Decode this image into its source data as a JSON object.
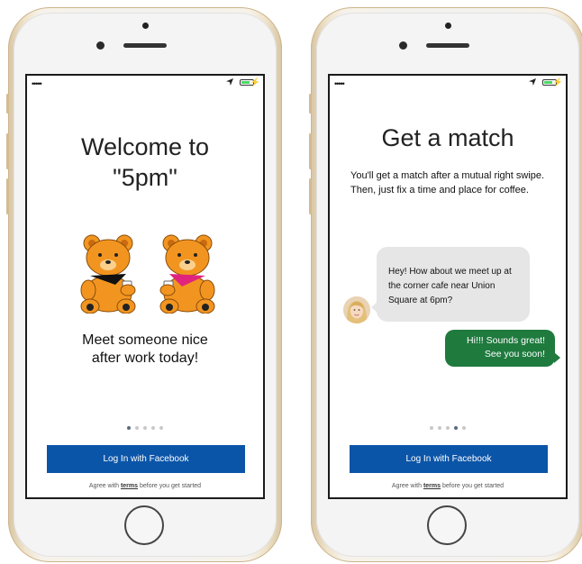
{
  "status": {
    "signal": "•••••",
    "charge": "⚡"
  },
  "screens": [
    {
      "id": "welcome",
      "title": "Welcome to\n\"5pm\"",
      "tagline": "Meet someone nice\nafter work today!",
      "dots_total": 5,
      "active_dot": 0,
      "login_button": "Log In with Facebook",
      "terms": {
        "before": "Agree with ",
        "link": "terms",
        "after": " before you get started"
      }
    },
    {
      "id": "get-match",
      "title": "Get a match",
      "description": "You'll get a match after a mutual right swipe. Then, just fix a time and place for coffee.",
      "incoming_message": "Hey! How about we meet up at the corner cafe near Union Square at 6pm?",
      "outgoing_message": "Hi!!! Sounds great!\nSee you soon!",
      "dots_total": 5,
      "active_dot": 3,
      "login_button": "Log In with Facebook",
      "terms": {
        "before": "Agree with ",
        "link": "terms",
        "after": " before you get started"
      }
    }
  ],
  "colors": {
    "facebook_blue": "#0b55a8",
    "outgoing_bubble": "#1f7a3e",
    "incoming_bubble": "#e6e6e6",
    "bear_fur": "#f29520",
    "bandana_left": "#111111",
    "bandana_right": "#e0247d"
  },
  "icons": [
    "location-arrow-icon",
    "battery-icon",
    "bear-illustration",
    "coffee-cup-icon",
    "avatar"
  ]
}
